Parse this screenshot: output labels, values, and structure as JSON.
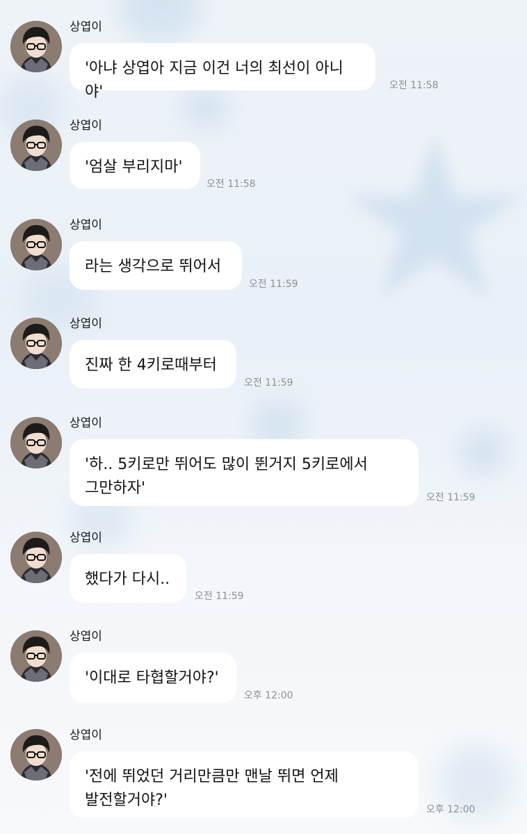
{
  "sender_name": "상엽이",
  "messages": [
    {
      "text": "'아냐 상엽아 지금 이건 너의 최선이 아니야'",
      "time": "오전 11:58"
    },
    {
      "text": "'엄살 부리지마'",
      "time": "오전 11:58"
    },
    {
      "text": "라는 생각으로 뛰어서",
      "time": "오전 11:59"
    },
    {
      "text": "진짜 한 4키로때부터",
      "time": "오전 11:59"
    },
    {
      "text": "'하.. 5키로만 뛰어도 많이 뛴거지 5키로에서\n그만하자'",
      "time": "오전 11:59"
    },
    {
      "text": "했다가 다시..",
      "time": "오전 11:59"
    },
    {
      "text": "'이대로 타협할거야?'",
      "time": "오후 12:00"
    },
    {
      "text": "'전에 뛰었던 거리만큼만 맨날 뛰면 언제\n발전할거야?'",
      "time": "오후 12:00"
    }
  ],
  "colors": {
    "bubble": "#ffffff",
    "time_text": "#8f8f8f",
    "background": "#eef3f8"
  },
  "icons": {
    "avatar": "profile-photo"
  }
}
